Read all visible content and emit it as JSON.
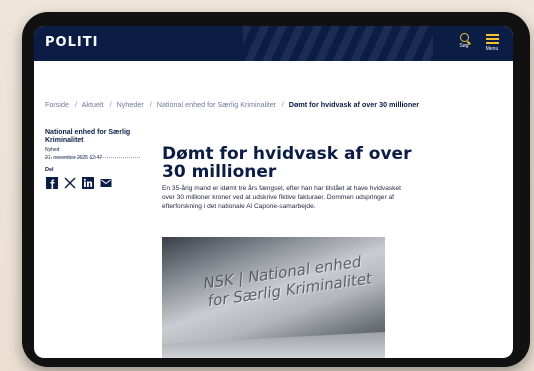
{
  "site": {
    "logo": "POLITI",
    "search_label": "Søg",
    "menu_label": "Menu",
    "brand_color": "#0b1c45",
    "accent_color": "#f1c232"
  },
  "breadcrumb": {
    "items": [
      "Forside",
      "Aktuelt",
      "Nyheder",
      "National enhed for Særlig Kriminalitet"
    ],
    "current": "Dømt for hvidvask af over 30 millioner"
  },
  "article_meta": {
    "unit": "National enhed for Særlig Kriminalitet",
    "type": "Nyhed",
    "date": "21. november 2025 12:47",
    "share_label": "Del",
    "share_icons": [
      "facebook-icon",
      "x-icon",
      "linkedin-icon",
      "mail-icon"
    ]
  },
  "article": {
    "title": "Dømt for hvidvask af over 30 millioner",
    "lead": "En 35-årig mand er idømt tre års fængsel, efter han har tilstået at have hvidvasket over 30 millioner kroner ved at udskrive fiktive fakturaer. Dommen udspringer af efterforskning i det nationale Al Capone-samarbejde."
  },
  "photo": {
    "sign_line1": "NSK | National enhed",
    "sign_line2": "for Særlig Kriminalitet"
  }
}
